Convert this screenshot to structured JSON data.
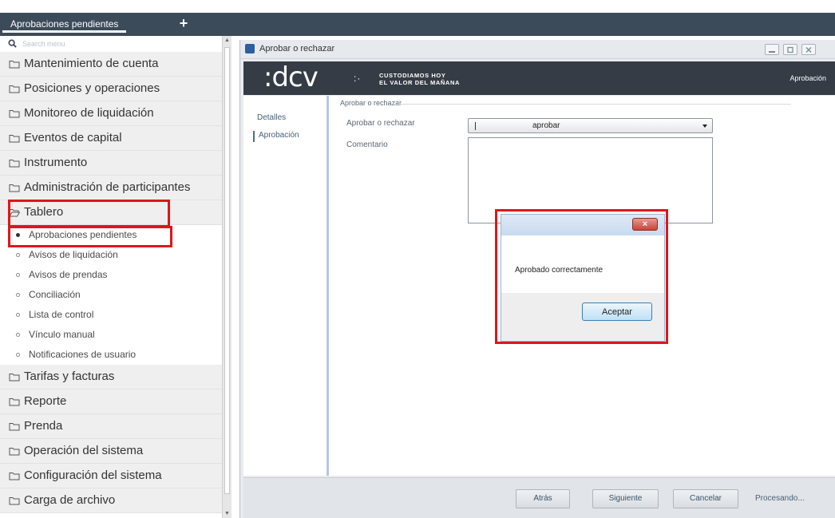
{
  "tabs": {
    "active_label": "Aprobaciones pendientes",
    "new_tab_glyph": "+"
  },
  "sidebar": {
    "search_placeholder": "Search menu",
    "menu_top": [
      "Mantenimiento de cuenta",
      "Posiciones y operaciones",
      "Monitoreo de liquidación",
      "Eventos de capital",
      "Instrumento",
      "Administración de participantes"
    ],
    "open_group": "Tablero",
    "submenu": [
      "Aprobaciones pendientes",
      "Avisos de liquidación",
      "Avisos de prendas",
      "Conciliación",
      "Lista de control",
      "Vínculo manual",
      "Notificaciones de usuario"
    ],
    "menu_bottom": [
      "Tarifas y facturas",
      "Reporte",
      "Prenda",
      "Operación del sistema",
      "Configuración del sistema",
      "Carga de archivo"
    ],
    "active_submenu_index": 0
  },
  "window": {
    "title": "Aprobar o rechazar",
    "brand": {
      "logo": ":dcv",
      "logo_tail": ":·",
      "slogan_line1": "CUSTODIAMOS HOY",
      "slogan_line2": "EL VALOR DEL MAÑANA",
      "right_label": "Aprobación"
    },
    "nav": {
      "detalles": "Detalles",
      "aprobacion": "Aprobación"
    },
    "form": {
      "section_title": "Aprobar o rechazar",
      "action_label": "Aprobar o rechazar",
      "action_value": "aprobar",
      "comment_label": "Comentario",
      "comment_value": ""
    },
    "footer": {
      "back": "Atrás",
      "next": "Siguiente",
      "cancel": "Cancelar",
      "status": "Procesando..."
    }
  },
  "modal": {
    "close_glyph": "×",
    "message": "Aprobado correctamente",
    "ok_label": "Aceptar"
  },
  "colors": {
    "tab_bar": "#3c4b5a",
    "banner": "#353c45",
    "highlight": "#e2141a",
    "menu_bg": "#efefef"
  }
}
